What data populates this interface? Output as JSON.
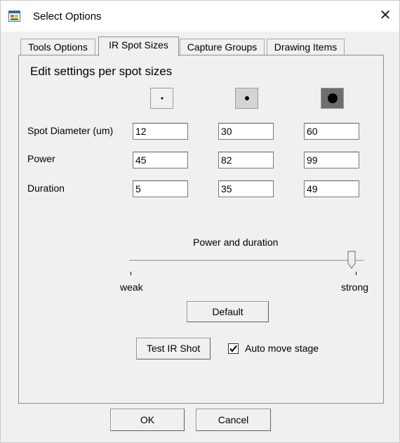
{
  "window": {
    "title": "Select Options",
    "close_icon": "close-icon",
    "app_icon": "app-window-icon"
  },
  "tabs": [
    {
      "label": "Tools Options",
      "active": false
    },
    {
      "label": "IR Spot Sizes",
      "active": true
    },
    {
      "label": "Capture Groups",
      "active": false
    },
    {
      "label": "Drawing Items",
      "active": false
    }
  ],
  "panel": {
    "heading": "Edit settings per spot sizes",
    "spot_buttons": [
      "small-spot-icon",
      "medium-spot-icon",
      "large-spot-icon"
    ],
    "rows": [
      {
        "label": "Spot Diameter (um)",
        "values": [
          "12",
          "30",
          "60"
        ]
      },
      {
        "label": "Power",
        "values": [
          "45",
          "82",
          "99"
        ]
      },
      {
        "label": "Duration",
        "values": [
          "5",
          "35",
          "49"
        ]
      }
    ],
    "slider": {
      "label": "Power and duration",
      "min_label": "weak",
      "max_label": "strong",
      "position_fraction": 0.94
    },
    "default_button": "Default",
    "test_button": "Test IR Shot",
    "auto_move": {
      "label": "Auto move stage",
      "checked": true
    }
  },
  "footer": {
    "ok": "OK",
    "cancel": "Cancel"
  }
}
